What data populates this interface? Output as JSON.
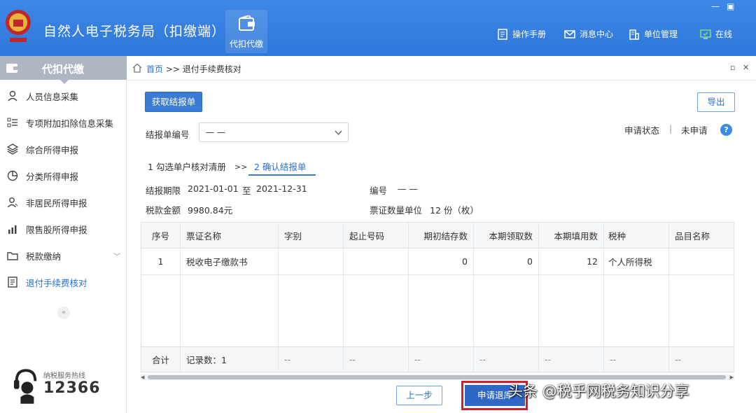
{
  "app": {
    "title": "自然人电子税务局（扣缴端）",
    "nav_tile": "代扣代缴",
    "toolbar": {
      "manual": "操作手册",
      "messages": "消息中心",
      "unit": "单位管理",
      "status": "在线"
    }
  },
  "sidebar": {
    "header": "代扣代缴",
    "items": [
      {
        "label": "人员信息采集",
        "icon": "person-icon"
      },
      {
        "label": "专项附加扣除信息采集",
        "icon": "list-icon"
      },
      {
        "label": "综合所得申报",
        "icon": "layers-icon"
      },
      {
        "label": "分类所得申报",
        "icon": "pie-icon"
      },
      {
        "label": "非居民所得申报",
        "icon": "person-outline-icon"
      },
      {
        "label": "限售股所得申报",
        "icon": "bars-icon"
      },
      {
        "label": "税款缴纳",
        "icon": "folder-icon"
      },
      {
        "label": "退付手续费核对",
        "icon": "document-icon"
      }
    ],
    "collapse": "«",
    "hotline": {
      "label": "纳税服务热线",
      "number": "12366"
    }
  },
  "breadcrumb": {
    "home": "首页",
    "separator": ">>",
    "current": "退付手续费核对"
  },
  "actions": {
    "fetch": "获取结报单",
    "export": "导出"
  },
  "filter": {
    "label": "结报单编号",
    "value": "— —",
    "status_label": "申请状态",
    "status_sep": "|",
    "status_value": "未申请",
    "help": "?"
  },
  "steps": [
    {
      "label": "1 勾选单户核对清册"
    },
    {
      "label": ">>"
    },
    {
      "label": "2 确认结报单"
    }
  ],
  "summary": {
    "period_label": "结报期限",
    "period_from": "2021-01-01",
    "period_to_sep": "至",
    "period_to": "2021-12-31",
    "number_label": "编号",
    "number_value": "— —",
    "amount_label": "税款金额",
    "amount_value": "9980.84元",
    "count_label": "票证数量单位",
    "count_value": "12 份（枚）"
  },
  "table": {
    "headers": [
      "序号",
      "票证名称",
      "字别",
      "起止号码",
      "期初结存数",
      "本期领取数",
      "本期填用数",
      "税种",
      "品目名称"
    ],
    "rows": [
      [
        "1",
        "税收电子缴款书",
        "",
        "",
        "0",
        "0",
        "12",
        "个人所得税",
        ""
      ]
    ],
    "footer": [
      "合计",
      "记录数：1",
      "--",
      "--",
      "--",
      "--",
      "--",
      "--",
      "--"
    ]
  },
  "footer_buttons": {
    "prev": "上一步",
    "apply": "申请退库"
  },
  "watermark": "头条 @税乎网税务知识分享",
  "colors": {
    "topbar": "#2f78dc",
    "primary": "#3a7bd5",
    "highlight": "#d21f2c",
    "sidebar_header": "#aeb6c1"
  }
}
